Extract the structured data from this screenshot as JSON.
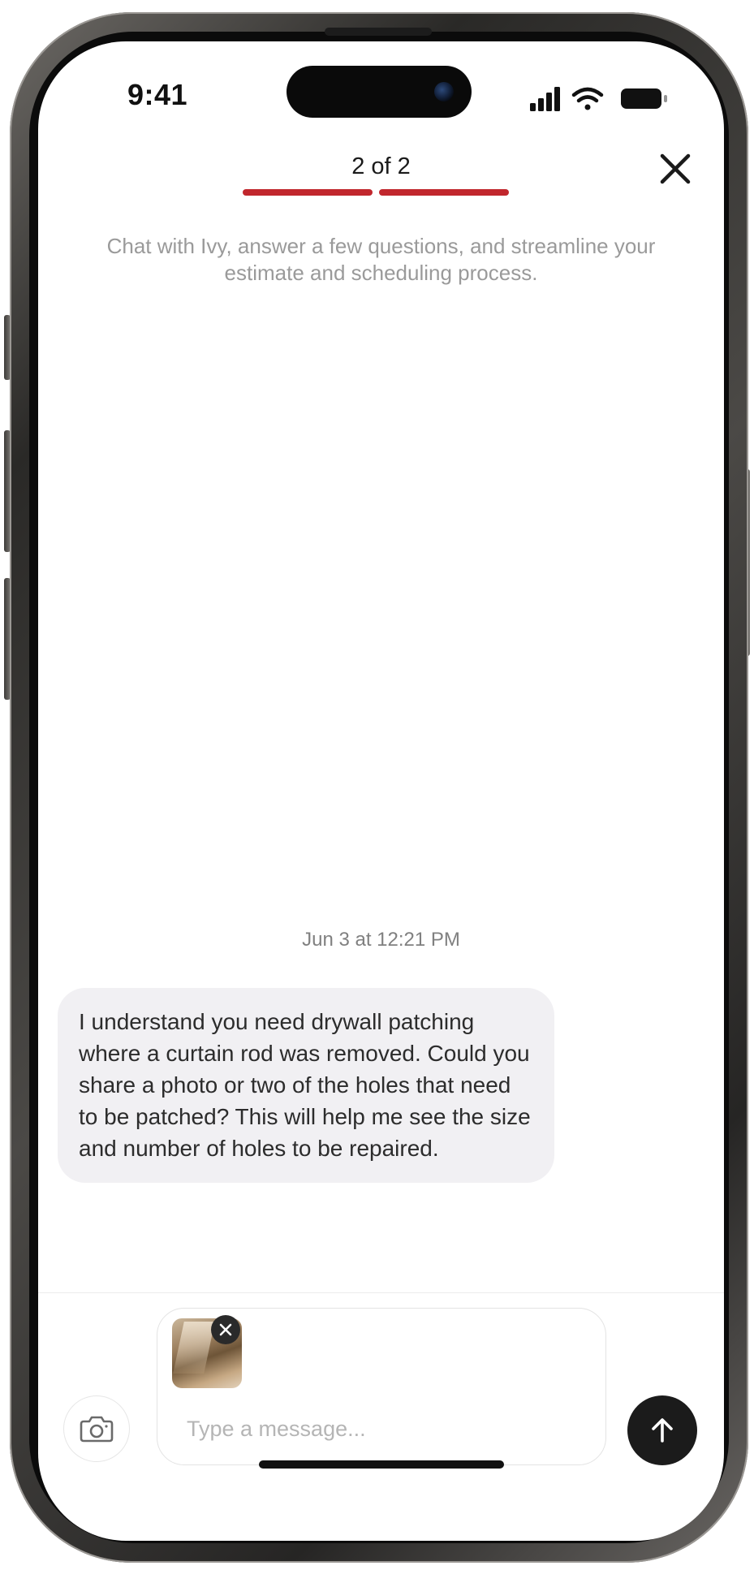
{
  "status_bar": {
    "time": "9:41",
    "signal_icon": "cellular-signal-icon",
    "wifi_icon": "wifi-icon",
    "battery_icon": "battery-icon"
  },
  "header": {
    "step_label": "2 of 2",
    "progress": {
      "current_step": 2,
      "total_steps": 2,
      "color": "#c1272d"
    },
    "close_icon": "close-icon",
    "subtitle": "Chat with Ivy, answer a few questions, and streamline your estimate and scheduling process."
  },
  "chat": {
    "timestamp": "Jun 3 at 12:21 PM",
    "messages": [
      {
        "text": "I understand you need drywall patching where a curtain rod was removed. Could you share a photo or two of the holes that need to be patched? This will help me see the size and number of holes to be repaired."
      }
    ]
  },
  "composer": {
    "camera_icon": "camera-icon",
    "attachment_remove_icon": "close-icon",
    "placeholder": "Type a message...",
    "value": "",
    "send_icon": "arrow-up-icon"
  },
  "colors": {
    "accent": "#c1272d",
    "bubble_bg": "#f1f0f3",
    "send_button": "#1b1b1b"
  }
}
